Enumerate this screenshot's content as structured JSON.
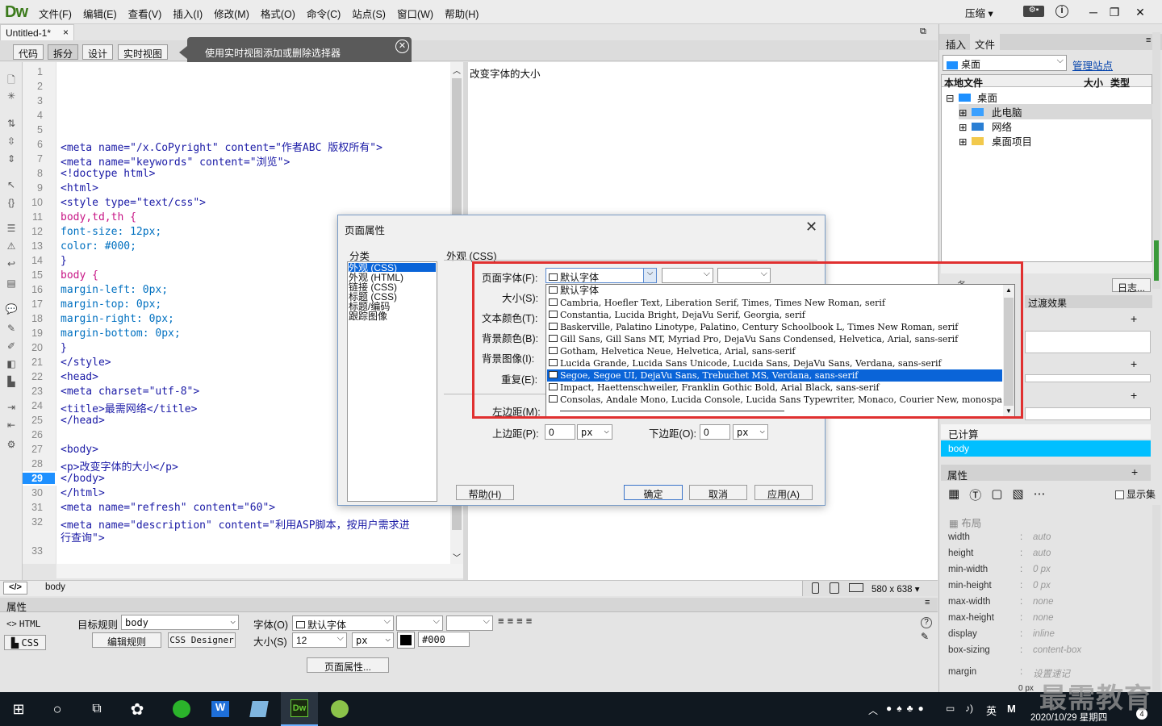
{
  "app": {
    "logo": "Dw",
    "menus": [
      "文件(F)",
      "编辑(E)",
      "查看(V)",
      "插入(I)",
      "修改(M)",
      "格式(O)",
      "命令(C)",
      "站点(S)",
      "窗口(W)",
      "帮助(H)"
    ],
    "compress": "压缩",
    "compress_arrow": "▾",
    "min": "─",
    "restore": "❐",
    "close": "✕"
  },
  "document": {
    "tab": "Untitled-1*",
    "tab_close": "×",
    "views": [
      "代码",
      "拆分",
      "设计",
      "实时视图"
    ],
    "tooltip": "使用实时视图添加或删除选择器",
    "tooltip_close": "✕"
  },
  "code": {
    "line_numbers": [
      "1",
      "2",
      "3",
      "4",
      "5",
      "6",
      "7",
      "8",
      "9",
      "10",
      "11",
      "12",
      "13",
      "14",
      "15",
      "16",
      "17",
      "18",
      "19",
      "20",
      "21",
      "22",
      "23",
      "24",
      "25",
      "26",
      "27",
      "28",
      "29",
      "30",
      "31",
      "32",
      "",
      "33"
    ],
    "lines": [
      "",
      "",
      "",
      "",
      "",
      "<meta name=\"/x.CoPyright\" content=\"作者ABC 版权所有\">",
      "<meta name=\"keywords\" content=\"浏览\">",
      "<!doctype html>",
      "<html>",
      "<style type=\"text/css\">",
      "body,td,th {",
      "    font-size: 12px;",
      "    color: #000;",
      "}",
      "body {",
      "    margin-left: 0px;",
      "    margin-top: 0px;",
      "    margin-right: 0px;",
      "    margin-bottom: 0px;",
      "}",
      "</style>",
      "<head>",
      "<meta charset=\"utf-8\">",
      "<title>最需网络</title>",
      "</head>",
      "",
      "<body>",
      "   <p>改变字体的大小</p>",
      "</body>",
      "</html>",
      "<meta name=\"refresh\" content=\"60\">",
      "<meta name=\"description\" content=\"利用ASP脚本，按用户需求进",
      "行查询\">",
      ""
    ]
  },
  "design": {
    "text": "改变字体的大小"
  },
  "status": {
    "tag": "body",
    "size": "580 x 638",
    "size_arrow": "▾",
    "code_icon": "</>"
  },
  "properties": {
    "title": "属性",
    "html": "HTML",
    "css": "CSS",
    "target_rule_label": "目标规则",
    "target_rule": "body",
    "edit_rule": "编辑规则",
    "css_designer": "CSS Designer",
    "font_label": "字体(O)",
    "font_value": "默认字体",
    "size_label": "大小(S)",
    "size_value": "12",
    "size_unit": "px",
    "color": "#000",
    "page_props": "页面属性...",
    "help_icon": "?"
  },
  "right_panel": {
    "tabs": [
      "插入",
      "文件"
    ],
    "location": "桌面",
    "manage": "管理站点",
    "col_local": "本地文件",
    "col_size": "大小",
    "col_type": "类型",
    "tree": [
      "桌面",
      "此电脑",
      "网络",
      "桌面项目"
    ],
    "backup": "备",
    "log": "日志...",
    "transitions": "过渡效果",
    "computed": "已计算",
    "selector": "body",
    "props_title": "属性",
    "show_set": "显示集",
    "layout": "布局",
    "css_props": [
      {
        "name": "width",
        "value": "auto"
      },
      {
        "name": "height",
        "value": "auto"
      },
      {
        "name": "min-width",
        "value": "0 px"
      },
      {
        "name": "min-height",
        "value": "0 px"
      },
      {
        "name": "max-width",
        "value": "none"
      },
      {
        "name": "max-height",
        "value": "none"
      },
      {
        "name": "display",
        "value": "inline"
      },
      {
        "name": "box-sizing",
        "value": "content-box"
      }
    ],
    "margin": "margin",
    "margin_val": "设置速记",
    "margin_zero": "0 px"
  },
  "dialog": {
    "title": "页面属性",
    "category_label": "分类",
    "category_items": [
      "外观 (CSS)",
      "外观 (HTML)",
      "链接 (CSS)",
      "标题 (CSS)",
      "标题/编码",
      "跟踪图像"
    ],
    "section": "外观 (CSS)",
    "page_font_label": "页面字体(F):",
    "page_font_value": "默认字体",
    "size_label": "大小(S):",
    "text_color_label": "文本颜色(T):",
    "bg_color_label": "背景颜色(B):",
    "bg_image_label": "背景图像(I):",
    "repeat_label": "重复(E):",
    "left_margin_label": "左边距(M):",
    "top_margin_label": "上边距(P):",
    "top_margin_value": "0",
    "top_unit": "px",
    "bottom_margin_label": "下边距(O):",
    "bottom_margin_value": "0",
    "bottom_unit": "px",
    "help": "帮助(H)",
    "ok": "确定",
    "cancel": "取消",
    "apply": "应用(A)",
    "font_options": [
      "默认字体",
      "Cambria, Hoefler Text, Liberation Serif, Times, Times New Roman, serif",
      "Constantia, Lucida Bright, DejaVu Serif, Georgia, serif",
      "Baskerville, Palatino Linotype, Palatino, Century Schoolbook L, Times New Roman, serif",
      "Gill Sans, Gill Sans MT, Myriad Pro, DejaVu Sans Condensed, Helvetica, Arial, sans-serif",
      "Gotham, Helvetica Neue, Helvetica, Arial, sans-serif",
      "Lucida Grande, Lucida Sans Unicode, Lucida Sans, DejaVu Sans, Verdana, sans-serif",
      "Segoe, Segoe UI, DejaVu Sans, Trebuchet MS, Verdana, sans-serif",
      "Impact, Haettenschweiler, Franklin Gothic Bold, Arial Black, sans-serif",
      "Consolas, Andale Mono, Lucida Console, Lucida Sans Typewriter, Monaco, Courier New, monospa"
    ],
    "selected_index": 7
  },
  "taskbar": {
    "time": "2020/10/29 星期四",
    "ime": "英",
    "ime2": "M",
    "vol": "♪)",
    "notif": "4"
  },
  "watermark": "最需教育",
  "colors": {
    "accent": "#0a64d8",
    "red_box": "#e03030",
    "line_active": "#1e90ff"
  }
}
